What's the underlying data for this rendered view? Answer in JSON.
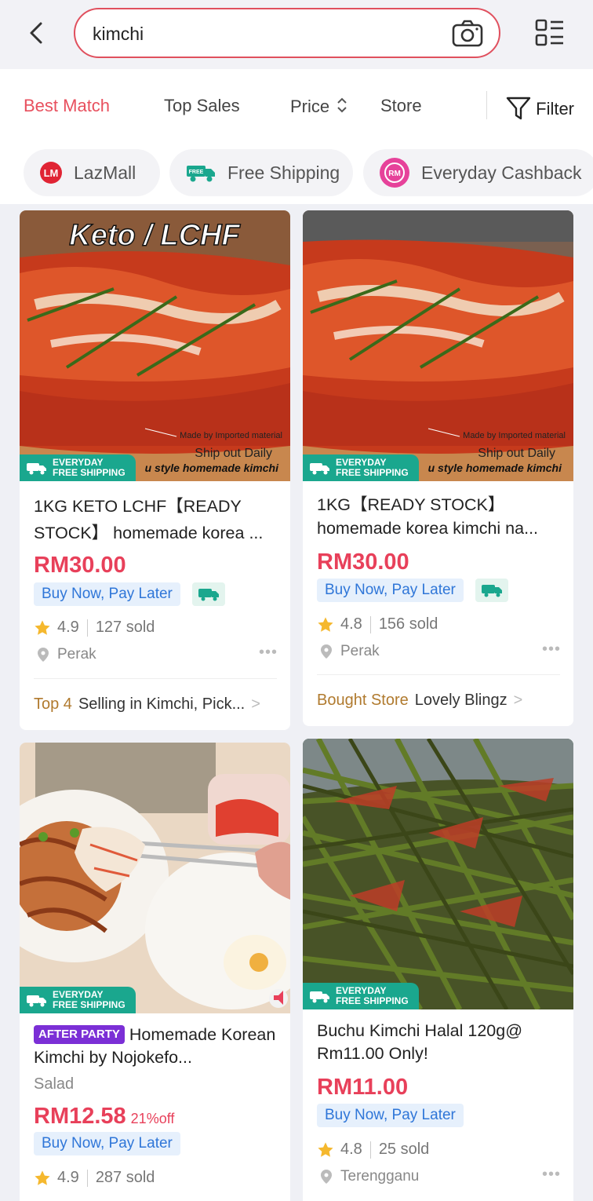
{
  "search": {
    "query": "kimchi"
  },
  "sort_tabs": [
    "Best Match",
    "Top Sales",
    "Price",
    "Store"
  ],
  "filter_label": "Filter",
  "chips": [
    "LazMall",
    "Free Shipping",
    "Everyday Cashback"
  ],
  "badge": {
    "line1": "EVERYDAY",
    "line2": "FREE SHIPPING",
    "free_icon_text": "FREE"
  },
  "image_texts": {
    "keto": "Keto / LCHF",
    "made_by": "Made by Imported material",
    "ship_out": "Ship out Daily",
    "bottom": "u style homemade kimchi"
  },
  "products": [
    {
      "title": "1KG KETO LCHF【READY STOCK】 homemade korea ...",
      "price": "RM30.00",
      "bnpl": "Buy Now, Pay Later",
      "rating": "4.9",
      "sold": "127 sold",
      "location": "Perak",
      "footer_key": "Top 4",
      "footer_value": "Selling in Kimchi, Pick..."
    },
    {
      "title": "1KG【READY STOCK】homemade korea kimchi na...",
      "price": "RM30.00",
      "bnpl": "Buy Now, Pay Later",
      "rating": "4.8",
      "sold": "156 sold",
      "location": "Perak",
      "footer_key": "Bought Store",
      "footer_value": "Lovely Blingz"
    },
    {
      "tag": "AFTER PARTY",
      "title": "Homemade Korean Kimchi by Nojokefo...",
      "subcategory": "Salad",
      "price": "RM12.58",
      "discount": "21%off",
      "bnpl": "Buy Now, Pay Later",
      "rating": "4.9",
      "sold": "287 sold"
    },
    {
      "title": "Buchu Kimchi Halal 120g@ Rm11.00 Only!",
      "price": "RM11.00",
      "bnpl": "Buy Now, Pay Later",
      "rating": "4.8",
      "sold": "25 sold",
      "location": "Terengganu"
    }
  ],
  "colors": {
    "accent": "#e8505e",
    "price": "#e8405a",
    "bnpl_bg": "#e6f0fc",
    "bnpl_text": "#2f76d8",
    "ship_badge": "#1aa78e",
    "footer_key": "#b07a2e"
  }
}
